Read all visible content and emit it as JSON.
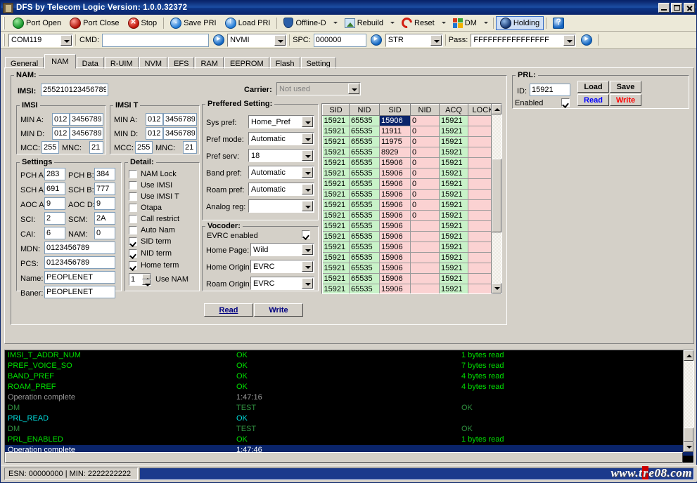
{
  "window": {
    "title": "DFS by Telecom Logic  Version: 1.0.0.32372",
    "minimize": "Minimize",
    "maximize": "Maximize",
    "close": "Close"
  },
  "toolbar": {
    "buttons": [
      {
        "label": "Port Open",
        "icon": "green-shield-icon",
        "dropdown": false,
        "active": false
      },
      {
        "label": "Port Close",
        "icon": "red-shield-icon",
        "dropdown": false,
        "active": false
      },
      {
        "label": "Stop",
        "icon": "red-x-icon",
        "dropdown": false,
        "active": false
      },
      {
        "label": "Save PRI",
        "icon": "download-icon",
        "dropdown": false,
        "active": false
      },
      {
        "label": "Load PRI",
        "icon": "upload-icon",
        "dropdown": false,
        "active": false
      },
      {
        "label": "Offline-D",
        "icon": "blue-shield-icon",
        "dropdown": true,
        "active": false
      },
      {
        "label": "Rebuild",
        "icon": "picture-icon",
        "dropdown": true,
        "active": false
      },
      {
        "label": "Reset",
        "icon": "refresh-icon",
        "dropdown": true,
        "active": false
      },
      {
        "label": "DM",
        "icon": "windows-flag-icon",
        "dropdown": true,
        "active": false
      },
      {
        "label": "Holding",
        "icon": "holding-icon",
        "dropdown": false,
        "active": true
      },
      {
        "label": "",
        "icon": "help-icon",
        "dropdown": false,
        "active": false
      }
    ]
  },
  "cmdbar": {
    "port_value": "COM119",
    "cmd_label": "CMD:",
    "cmd_value": "",
    "run_cmd_icon": "run-icon",
    "mode_value": "NVMI",
    "spc_label": "SPC:",
    "spc_value": "000000",
    "str_value": "STR",
    "pass_label": "Pass:",
    "pass_value": "FFFFFFFFFFFFFFFF",
    "run_pass_icon": "run-icon"
  },
  "tabs": [
    {
      "label": "General",
      "selected": false
    },
    {
      "label": "NAM",
      "selected": true
    },
    {
      "label": "Data",
      "selected": false
    },
    {
      "label": "R-UIM",
      "selected": false
    },
    {
      "label": "NVM",
      "selected": false
    },
    {
      "label": "EFS",
      "selected": false
    },
    {
      "label": "RAM",
      "selected": false
    },
    {
      "label": "EEPROM",
      "selected": false
    },
    {
      "label": "Flash",
      "selected": false
    },
    {
      "label": "Setting",
      "selected": false
    }
  ],
  "nam": {
    "group_label": "NAM:",
    "imsi_label": "IMSI:",
    "imsi_value": "255210123456789",
    "carrier_label": "Carrier:",
    "carrier_value": "Not used",
    "imsi_group": {
      "title": "IMSI",
      "min_a_label": "MIN A:",
      "min_a_1": "012",
      "min_a_2": "3456789",
      "min_d_label": "MIN D:",
      "min_d_1": "012",
      "min_d_2": "3456789",
      "mcc_label": "MCC:",
      "mcc_value": "255",
      "mnc_label": "MNC:",
      "mnc_value": "21"
    },
    "imsi_t_group": {
      "title": "IMSI T",
      "min_a_label": "MIN A:",
      "min_a_1": "012",
      "min_a_2": "3456789",
      "min_d_label": "MIN D:",
      "min_d_1": "012",
      "min_d_2": "3456789",
      "mcc_label": "MCC:",
      "mcc_value": "255",
      "mnc_label": "MNC:",
      "mnc_value": "21"
    },
    "settings": {
      "title": "Settings",
      "pch_a_label": "PCH A:",
      "pch_a_value": "283",
      "pch_b_label": "PCH B:",
      "pch_b_value": "384",
      "sch_a_label": "SCH A:",
      "sch_a_value": "691",
      "sch_b_label": "SCH B:",
      "sch_b_value": "777",
      "aoc_a_label": "AOC A:",
      "aoc_a_value": "9",
      "aoc_d_label": "AOC D:",
      "aoc_d_value": "9",
      "sci_label": "SCI:",
      "sci_value": "2",
      "scm_label": "SCM:",
      "scm_value": "2A",
      "cai_label": "CAI:",
      "cai_value": "6",
      "nam_label": "NAM:",
      "nam_value": "0",
      "mdn_label": "MDN:",
      "mdn_value": "0123456789",
      "pcs_label": "PCS:",
      "pcs_value": "0123456789",
      "name_label": "Name:",
      "name_value": "PEOPLENET",
      "baner_label": "Baner:",
      "baner_value": "PEOPLENET"
    },
    "detail": {
      "title": "Detail:",
      "items": [
        {
          "label": "NAM Lock",
          "checked": false
        },
        {
          "label": "Use IMSI",
          "checked": false
        },
        {
          "label": "Use IMSI T",
          "checked": false
        },
        {
          "label": "Otapa",
          "checked": false
        },
        {
          "label": "Call restrict",
          "checked": false
        },
        {
          "label": "Auto Nam",
          "checked": false
        },
        {
          "label": "SID term",
          "checked": true
        },
        {
          "label": "NID term",
          "checked": true
        },
        {
          "label": "Home term",
          "checked": true
        }
      ],
      "use_nam_value": "1",
      "use_nam_label": "Use NAM"
    },
    "preferred": {
      "title": "Preffered Setting:",
      "rows": [
        {
          "label": "Sys pref:",
          "value": "Home_Pref"
        },
        {
          "label": "Pref mode:",
          "value": "Automatic"
        },
        {
          "label": "Pref serv:",
          "value": "18"
        },
        {
          "label": "Band pref:",
          "value": "Automatic"
        },
        {
          "label": "Roam pref:",
          "value": "Automatic"
        },
        {
          "label": "Analog reg:",
          "value": ""
        }
      ]
    },
    "vocoder": {
      "title": "Vocoder:",
      "evrc_label": "EVRC enabled",
      "evrc_checked": true,
      "rows": [
        {
          "label": "Home Page:",
          "value": "Wild"
        },
        {
          "label": "Home Origin:",
          "value": "EVRC"
        },
        {
          "label": "Roam Origin:",
          "value": "EVRC"
        }
      ]
    },
    "read_label": "Read",
    "write_label": "Write"
  },
  "prl": {
    "title": "PRL:",
    "id_label": "ID:",
    "id_value": "15921",
    "enabled_label": "Enabled",
    "enabled_checked": true,
    "load_label": "Load",
    "save_label": "Save",
    "read_label": "Read",
    "write_label": "Write",
    "read_color": "#0000ff",
    "write_color": "#ff0000"
  },
  "grid": {
    "columns": [
      "SID",
      "NID",
      "SID",
      "NID",
      "ACQ",
      "LOCK"
    ],
    "rows": [
      {
        "sid1": "15921",
        "nid1": "65535",
        "sid2": "15906",
        "nid2": "0",
        "acq": "15921",
        "lock": "",
        "selected": true
      },
      {
        "sid1": "15921",
        "nid1": "65535",
        "sid2": "11911",
        "nid2": "0",
        "acq": "15921",
        "lock": ""
      },
      {
        "sid1": "15921",
        "nid1": "65535",
        "sid2": "11975",
        "nid2": "0",
        "acq": "15921",
        "lock": ""
      },
      {
        "sid1": "15921",
        "nid1": "65535",
        "sid2": "8929",
        "nid2": "0",
        "acq": "15921",
        "lock": ""
      },
      {
        "sid1": "15921",
        "nid1": "65535",
        "sid2": "15906",
        "nid2": "0",
        "acq": "15921",
        "lock": ""
      },
      {
        "sid1": "15921",
        "nid1": "65535",
        "sid2": "15906",
        "nid2": "0",
        "acq": "15921",
        "lock": ""
      },
      {
        "sid1": "15921",
        "nid1": "65535",
        "sid2": "15906",
        "nid2": "0",
        "acq": "15921",
        "lock": ""
      },
      {
        "sid1": "15921",
        "nid1": "65535",
        "sid2": "15906",
        "nid2": "0",
        "acq": "15921",
        "lock": ""
      },
      {
        "sid1": "15921",
        "nid1": "65535",
        "sid2": "15906",
        "nid2": "0",
        "acq": "15921",
        "lock": ""
      },
      {
        "sid1": "15921",
        "nid1": "65535",
        "sid2": "15906",
        "nid2": "0",
        "acq": "15921",
        "lock": ""
      },
      {
        "sid1": "15921",
        "nid1": "65535",
        "sid2": "15906",
        "nid2": "",
        "acq": "15921",
        "lock": ""
      },
      {
        "sid1": "15921",
        "nid1": "65535",
        "sid2": "15906",
        "nid2": "",
        "acq": "15921",
        "lock": ""
      },
      {
        "sid1": "15921",
        "nid1": "65535",
        "sid2": "15906",
        "nid2": "",
        "acq": "15921",
        "lock": ""
      },
      {
        "sid1": "15921",
        "nid1": "65535",
        "sid2": "15906",
        "nid2": "",
        "acq": "15921",
        "lock": ""
      },
      {
        "sid1": "15921",
        "nid1": "65535",
        "sid2": "15906",
        "nid2": "",
        "acq": "15921",
        "lock": ""
      },
      {
        "sid1": "15921",
        "nid1": "65535",
        "sid2": "15906",
        "nid2": "",
        "acq": "15921",
        "lock": ""
      },
      {
        "sid1": "15921",
        "nid1": "65535",
        "sid2": "15906",
        "nid2": "",
        "acq": "15921",
        "lock": ""
      }
    ]
  },
  "log": {
    "entries": [
      {
        "c1": "IMSI_T_ADDR_NUM",
        "c2": "OK",
        "c3": "1 bytes read",
        "color": "#00e000",
        "selected": false
      },
      {
        "c1": "PREF_VOICE_SO",
        "c2": "OK",
        "c3": "7 bytes read",
        "color": "#00e000",
        "selected": false
      },
      {
        "c1": "BAND_PREF",
        "c2": "OK",
        "c3": "4 bytes read",
        "color": "#00e000",
        "selected": false
      },
      {
        "c1": "ROAM_PREF",
        "c2": "OK",
        "c3": "4 bytes read",
        "color": "#00e000",
        "selected": false
      },
      {
        "c1": "Operation complete",
        "c2": "1:47:16",
        "c3": "",
        "color": "#9a9a9a",
        "selected": false
      },
      {
        "c1": "DM",
        "c2": "TEST",
        "c3": "OK",
        "color": "#2f8f3f",
        "selected": false
      },
      {
        "c1": "PRL_READ",
        "c2": "OK",
        "c3": "",
        "color": "#00dddd",
        "selected": false
      },
      {
        "c1": "DM",
        "c2": "TEST",
        "c3": "OK",
        "color": "#2f8f3f",
        "selected": false
      },
      {
        "c1": "PRL_ENABLED",
        "c2": "OK",
        "c3": "1 bytes read",
        "color": "#00e000",
        "selected": false
      },
      {
        "c1": "Operation complete",
        "c2": "1:47:46",
        "c3": "",
        "color": "#ffffff",
        "selected": true
      }
    ]
  },
  "statusbar": {
    "esn_text": "ESN:  00000000  |  MIN:  2222222222",
    "progress": "",
    "watermark_a": "www.t",
    "watermark_r": "r",
    "watermark_b": "e08.com"
  }
}
